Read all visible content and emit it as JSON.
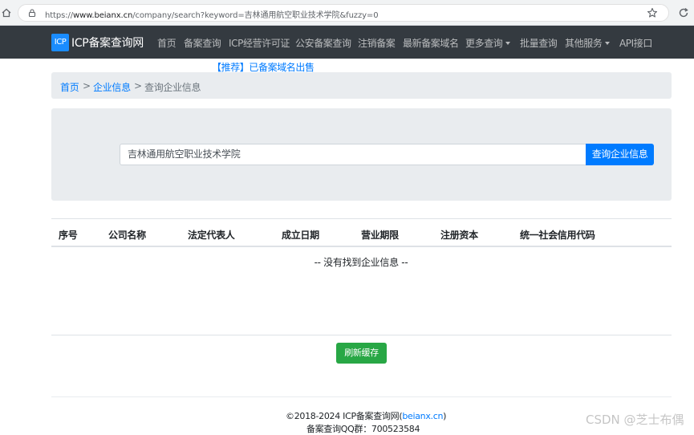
{
  "browser": {
    "url_prefix": "https://",
    "url_domain": "www.beianx.cn",
    "url_path": "/company/search?keyword=吉林通用航空职业技术学院&fuzzy=0"
  },
  "navbar": {
    "logo": "ICP",
    "brand": "ICP备案查询网",
    "links": [
      "首页",
      "备案查询",
      "ICP经营许可证",
      "公安备案查询",
      "注销备案",
      "最新备案域名",
      "更多查询",
      "批量查询",
      "其他服务",
      "API接口"
    ]
  },
  "promo": "【推荐】已备案域名出售",
  "breadcrumb": {
    "home": "首页",
    "section": "企业信息",
    "current": "查询企业信息",
    "separator": ">"
  },
  "search": {
    "value": "吉林通用航空职业技术学院",
    "button": "查询企业信息"
  },
  "table": {
    "headers": [
      "序号",
      "公司名称",
      "法定代表人",
      "成立日期",
      "营业期限",
      "注册资本",
      "统一社会信用代码"
    ],
    "empty": "-- 没有找到企业信息 --"
  },
  "refresh_button": "刷新缓存",
  "footer": {
    "copyright": "©2018-2024 ICP备案查询网",
    "link_open": "(",
    "link": "beianx.cn",
    "link_close": ")",
    "qq": "备案查询QQ群：700523584"
  },
  "watermark": "CSDN @芝士布偶",
  "colors": {
    "navbar": "#343a40",
    "primary": "#007bff",
    "success": "#28a745",
    "panel": "#e9ecef"
  }
}
